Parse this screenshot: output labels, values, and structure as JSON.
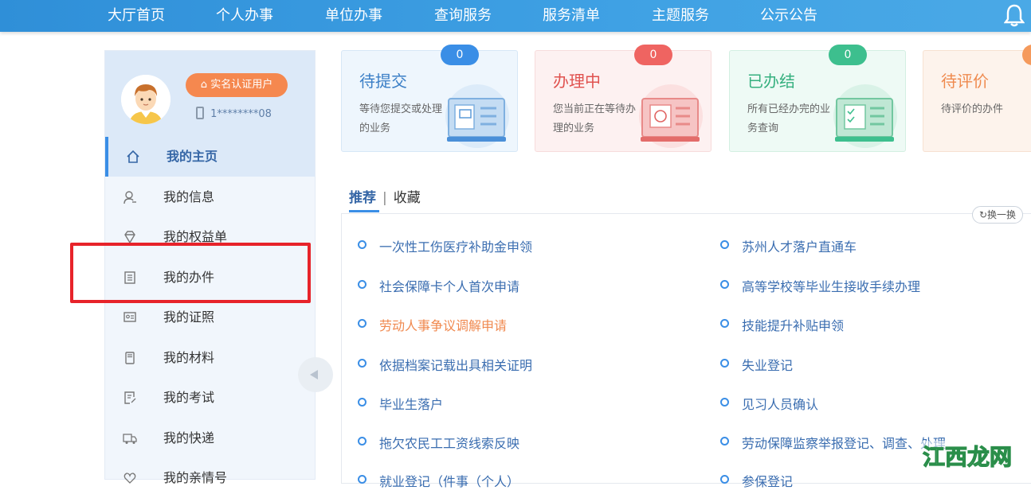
{
  "topnav": {
    "items": [
      {
        "label": "大厅首页"
      },
      {
        "label": "个人办事"
      },
      {
        "label": "单位办事"
      },
      {
        "label": "查询服务"
      },
      {
        "label": "服务清单"
      },
      {
        "label": "主题服务"
      },
      {
        "label": "公示公告"
      }
    ],
    "bell_icon": "bell-icon"
  },
  "profile": {
    "verified_badge": "实名认证用户",
    "phone": "1********08"
  },
  "sidebar": {
    "items": [
      {
        "label": "我的主页",
        "icon": "home-icon",
        "active": true
      },
      {
        "label": "我的信息",
        "icon": "user-icon"
      },
      {
        "label": "我的权益单",
        "icon": "diamond-icon"
      },
      {
        "label": "我的办件",
        "icon": "document-icon"
      },
      {
        "label": "我的证照",
        "icon": "id-card-icon"
      },
      {
        "label": "我的材料",
        "icon": "folder-icon"
      },
      {
        "label": "我的考试",
        "icon": "exam-icon"
      },
      {
        "label": "我的快递",
        "icon": "truck-icon"
      },
      {
        "label": "我的亲情号",
        "icon": "heart-icon"
      }
    ]
  },
  "status_cards": [
    {
      "title": "待提交",
      "desc": "等待您提交或处理的业务",
      "count": "0",
      "color": "#3a8ee6"
    },
    {
      "title": "办理中",
      "desc": "您当前正在等待办理的业务",
      "count": "0",
      "color": "#ef6461"
    },
    {
      "title": "已办结",
      "desc": "所有已经办完的业务查询",
      "count": "0",
      "color": "#3dbf8e"
    },
    {
      "title": "待评价",
      "desc": "待评价的办件",
      "count": "0",
      "color": "#f59a5c"
    }
  ],
  "tabs": {
    "active": "推荐",
    "separator": "|",
    "other": "收藏",
    "refresh": "换一换"
  },
  "services": {
    "left": [
      "一次性工伤医疗补助金申领",
      "社会保障卡个人首次申请",
      "劳动人事争议调解申请",
      "依据档案记载出具相关证明",
      "毕业生落户",
      "拖欠农民工工资线索反映",
      "就业登记（件事（个人）"
    ],
    "right": [
      "苏州人才落户直通车",
      "高等学校等毕业生接收手续办理",
      "技能提升补贴申领",
      "失业登记",
      "见习人员确认",
      "劳动保障监察举报登记、调查、处理",
      "参保登记"
    ]
  },
  "watermark": {
    "text": "江西龙网"
  }
}
